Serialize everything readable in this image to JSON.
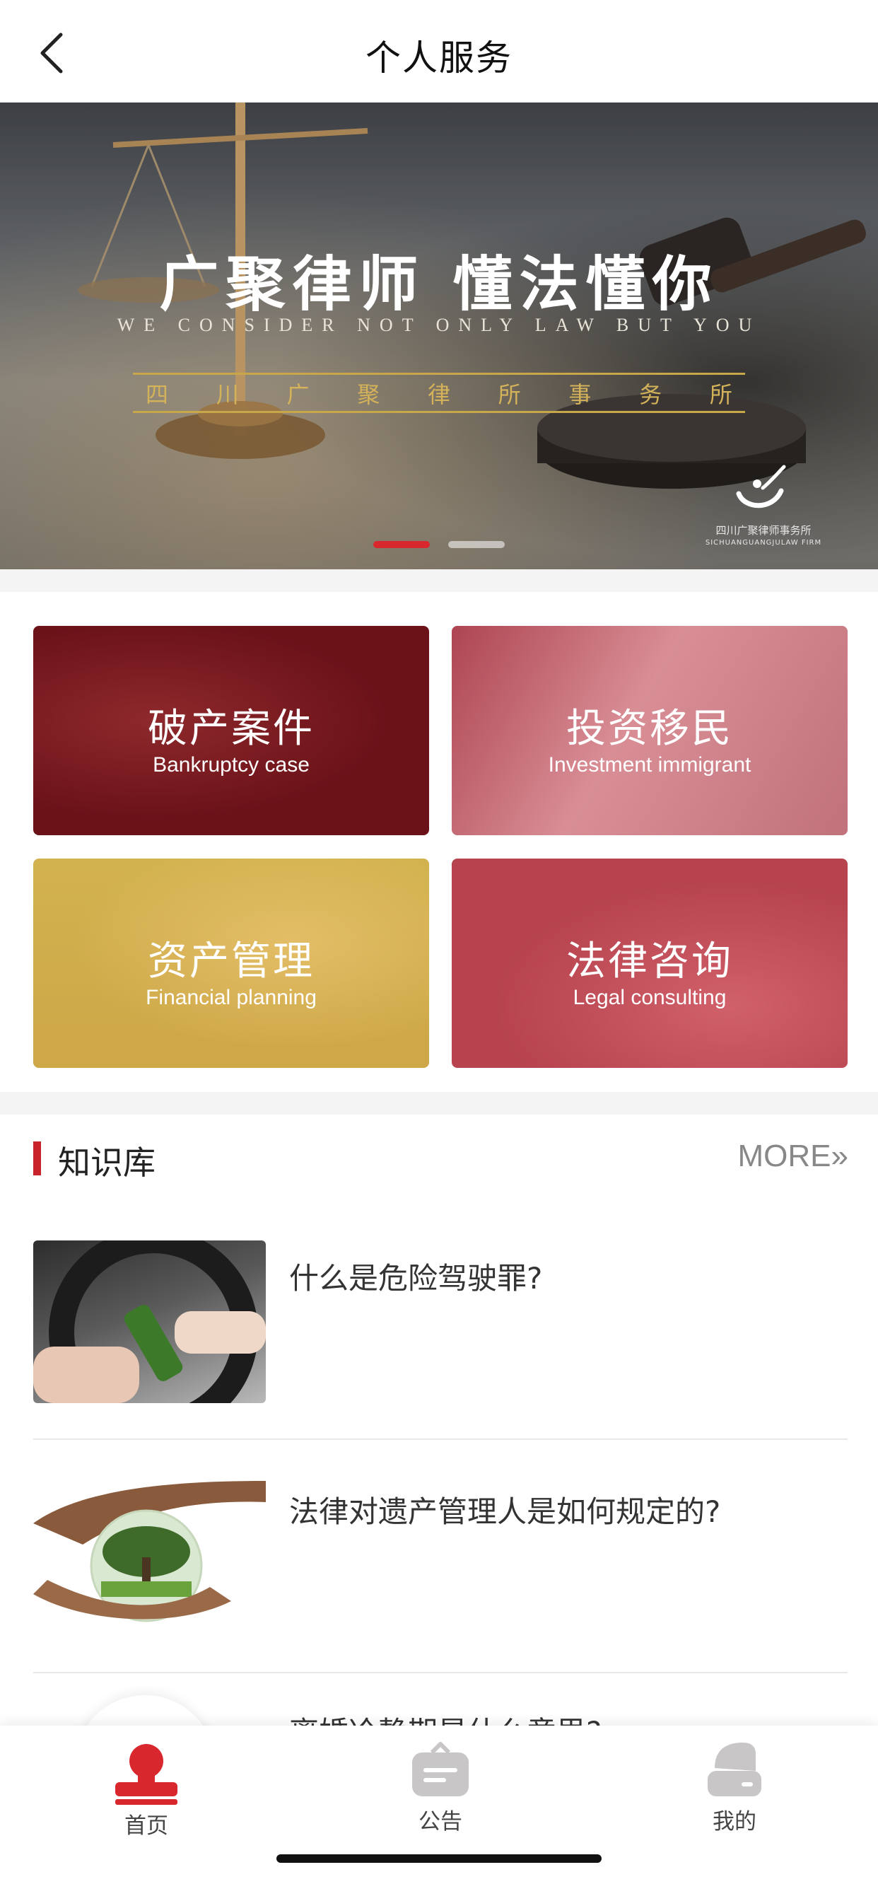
{
  "header": {
    "title": "个人服务"
  },
  "banner": {
    "headline": "广聚律师  懂法懂你",
    "tagline": "WE CONSIDER NOT ONLY LAW BUT YOU",
    "firm_chars": [
      "四",
      "川",
      "广",
      "聚",
      "律",
      "所",
      "事",
      "务",
      "所"
    ],
    "logo_cn": "四川广聚律师事务所",
    "logo_en": "SICHUANGUANGJULAW FIRM",
    "slides_total": 2,
    "active_slide": 1
  },
  "services": [
    {
      "cn": "破产案件",
      "en": "Bankruptcy case"
    },
    {
      "cn": "投资移民",
      "en": "Investment immigrant"
    },
    {
      "cn": "资产管理",
      "en": "Financial planning"
    },
    {
      "cn": "法律咨询",
      "en": "Legal consulting"
    }
  ],
  "knowledge": {
    "title": "知识库",
    "more": "MORE»",
    "articles": [
      {
        "title": "什么是危险驾驶罪?"
      },
      {
        "title": "法律对遗产管理人是如何规定的?"
      },
      {
        "title": "离婚冷静期是什么意思?"
      }
    ]
  },
  "tabbar": {
    "items": [
      {
        "label": "首页",
        "icon": "home-stamp-icon",
        "active": true
      },
      {
        "label": "公告",
        "icon": "notice-bag-icon",
        "active": false
      },
      {
        "label": "我的",
        "icon": "profile-icon",
        "active": false
      }
    ]
  },
  "colors": {
    "accent": "#d9272e",
    "brand_dark": "#6b1219",
    "gold": "#d3b25a"
  }
}
